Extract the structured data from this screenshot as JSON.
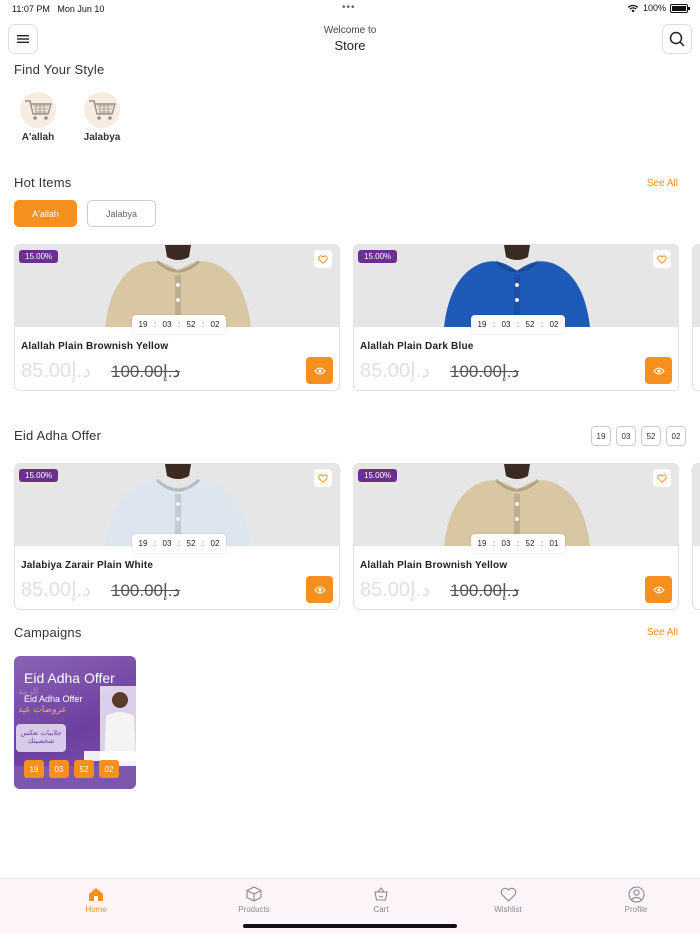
{
  "status_bar": {
    "time": "11:07 PM",
    "date": "Mon Jun 10",
    "battery": "100%",
    "battery_level": 1.0
  },
  "header": {
    "subtitle": "Welcome to",
    "title": "Store"
  },
  "find_style": {
    "title": "Find Your Style",
    "categories": [
      {
        "label": "A'allah",
        "icon": "cart-icon"
      },
      {
        "label": "Jalabya",
        "icon": "cart-icon"
      }
    ]
  },
  "hot_items": {
    "title": "Hot Items",
    "see_all": "See All",
    "filters": [
      "A'allah",
      "Jalabya"
    ],
    "active_filter": "A'allah",
    "products": [
      {
        "discount": "15.00%",
        "timer": [
          "19",
          "03",
          "52",
          "02"
        ],
        "name": "Alallah Plain Brownish Yellow",
        "price": "85.00د.إ",
        "old_price": "100.00د.إ",
        "garment_color": "#d9c7a3"
      },
      {
        "discount": "15.00%",
        "timer": [
          "19",
          "03",
          "52",
          "02"
        ],
        "name": "Alallah Plain Dark Blue",
        "price": "85.00د.إ",
        "old_price": "100.00د.إ",
        "garment_color": "#1e5bb8"
      }
    ]
  },
  "eid_offer": {
    "title": "Eid Adha Offer",
    "countdown": [
      "19",
      "03",
      "52",
      "02"
    ],
    "products": [
      {
        "discount": "15.00%",
        "timer": [
          "19",
          "03",
          "52",
          "02"
        ],
        "name": "Jalabiya Zarair Plain White",
        "price": "85.00د.إ",
        "old_price": "100.00د.إ",
        "garment_color": "#dde6ef"
      },
      {
        "discount": "15.00%",
        "timer": [
          "19",
          "03",
          "52",
          "01"
        ],
        "name": "Alallah Plain Brownish Yellow",
        "price": "85.00د.إ",
        "old_price": "100.00د.إ",
        "garment_color": "#d9c7a3"
      }
    ]
  },
  "campaigns": {
    "title": "Campaigns",
    "see_all": "See All",
    "items": [
      {
        "title": "Eid Adha Offer",
        "subtitle": "Eid Adha Offer",
        "arabic_faded": "الزينة",
        "arabic_title": "عروضات عيد",
        "arabic_banner": "جلابيات تعكس شخصيتك",
        "countdown": [
          "19",
          "03",
          "52",
          "02"
        ]
      }
    ]
  },
  "tabbar": {
    "tabs": [
      {
        "label": "Home",
        "icon": "home-icon"
      },
      {
        "label": "Products",
        "icon": "box-icon"
      },
      {
        "label": "Cart",
        "icon": "basket-icon"
      },
      {
        "label": "Wishlist",
        "icon": "heart-icon"
      },
      {
        "label": "Profile",
        "icon": "user-icon"
      }
    ],
    "active": "Home"
  },
  "colors": {
    "accent": "#f5901f",
    "discount_badge": "#6b2f8f",
    "campaign_purple": "#6d3fa0"
  }
}
